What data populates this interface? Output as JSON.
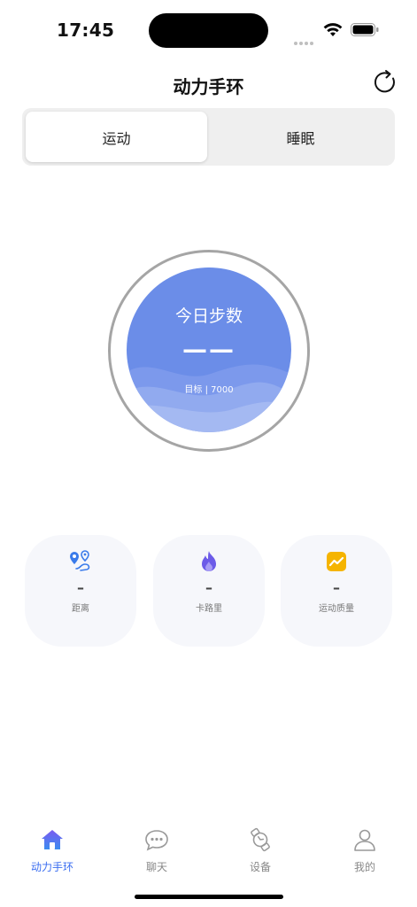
{
  "status_bar": {
    "time": "17:45"
  },
  "nav": {
    "title": "动力手环",
    "refresh_icon": "refresh-icon"
  },
  "segment": {
    "tabs": [
      "运动",
      "睡眠"
    ],
    "selected": "运动"
  },
  "steps": {
    "title": "今日步数",
    "value": "——",
    "goal": "目标 | 7000"
  },
  "stats": [
    {
      "icon": "location-route-icon",
      "value": "–",
      "label": "距离"
    },
    {
      "icon": "flame-icon",
      "value": "–",
      "label": "卡路里"
    },
    {
      "icon": "trend-chart-icon",
      "value": "–",
      "label": "运动质量"
    }
  ],
  "tabbar": {
    "items": [
      {
        "label": "动力手环",
        "icon": "home-icon"
      },
      {
        "label": "聊天",
        "icon": "chat-icon"
      },
      {
        "label": "设备",
        "icon": "watch-icon"
      },
      {
        "label": "我的",
        "icon": "user-icon"
      }
    ],
    "selected": "动力手环"
  },
  "colors": {
    "accent": "#3a6df0",
    "ring_fill": "#6b8de8",
    "ring_border": "#a5a5a5",
    "card_bg": "#f6f7fb",
    "flame": "#6c5be8",
    "trend_bg": "#f5b400"
  }
}
